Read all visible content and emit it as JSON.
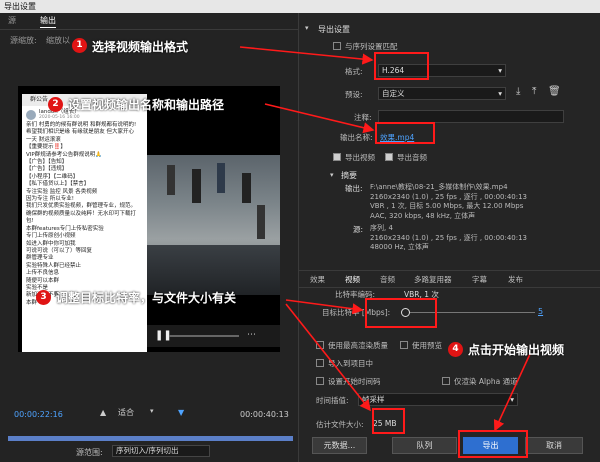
{
  "window": {
    "title": "导出设置"
  },
  "left": {
    "tabs": [
      "源",
      "输出"
    ],
    "source_scaling_label": "源缩放:",
    "source_scaling_value": "缩放以",
    "phone": {
      "group": "群公告",
      "author": "landon（组长）",
      "date": "2020-05-16 16:00",
      "lines": [
        "亲们 村勇的的候有群说明 和群规都有说明的!",
        "希望我们相识是缘 有缘就是朋友 但大家开心",
        "一天 财运滚滚",
        "【重要提示‼️】",
        "VIP群规请参考公告群规说明🙏",
        "【广告】【告知】",
        "【广告】【违规】",
        "【小程序】【二维码】",
        "【私下借贷以上】【禁言】",
        "专注实验 监控 风景 各类视频",
        "因为专注 所以专业!",
        "我们只发优质实验视频，群管理专业，规范。",
        "确保群的视频质量以及纯粹！无水印可下载打",
        "包!",
        "本群features专门上传私密实验",
        "专门上传原创小视频",
        "如进入群中你可加我",
        "可说可说（可以了）等回复",
        "群管理专业",
        "实验特殊人群已经禁止",
        "上传不良信息",
        "随便可以本群",
        "实验不是",
        "新加进入不要",
        "本群"
      ]
    },
    "timecode_in": "00:00:22:16",
    "fit": "适合",
    "timecode_out": "00:00:40:13",
    "range_label": "源范围:",
    "range_value": "序列切入/序列切出"
  },
  "right": {
    "section_title": "导出设置",
    "match_sequence": "与序列设置匹配",
    "format_label": "格式:",
    "format_value": "H.264",
    "preset_label": "预设:",
    "preset_value": "自定义",
    "comment_label": "注释:",
    "output_name_label": "输出名称:",
    "output_name_value": "效果.mp4",
    "export_video": "导出视频",
    "export_audio": "导出音频",
    "summary_title": "摘要",
    "output_label": "输出:",
    "output_lines": [
      "F:\\anne\\教程\\08-21_多媒体制作\\效果.mp4",
      "2160x2340 (1.0) , 25 fps , 逐行 , 00:00:40:13",
      "VBR , 1 次, 目标 5.00 Mbps, 最大 12.00 Mbps",
      "AAC, 320 kbps, 48 kHz, 立体声"
    ],
    "source_label": "源:",
    "source_lines": [
      "序列, 4",
      "2160x2340 (1.0) , 25 fps , 逐行 , 00:00:40:13",
      "48000 Hz, 立体声"
    ],
    "subtabs": [
      "效果",
      "视频",
      "音频",
      "多路复用器",
      "字幕",
      "发布"
    ],
    "bitrate_encoding": "比特率编码:",
    "bitrate_encoding_value": "VBR, 1 次",
    "target_bitrate_label": "目标比特率 [Mbps]:",
    "target_bitrate_value": "5",
    "max_render_quality": "使用最高渲染质量",
    "use_preview": "使用预览",
    "import_project": "导入到项目中",
    "set_start_timecode": "设置开始时间码",
    "alpha_only": "仅渲染 Alpha 通道",
    "time_interp_label": "时间插值:",
    "time_interp_value": "帧采样",
    "est_size_label": "估计文件大小:",
    "est_size_value": "25 MB",
    "btn_metadata": "元数据...",
    "btn_queue": "队列",
    "btn_export": "导出",
    "btn_cancel": "取消"
  },
  "callouts": [
    {
      "num": "1",
      "text": "选择视频输出格式"
    },
    {
      "num": "2",
      "text": "设置视频输出名称和输出路径"
    },
    {
      "num": "3",
      "text": "调整目标比特率，与文件大小有关"
    },
    {
      "num": "4",
      "text": "点击开始输出视频"
    }
  ],
  "colors": {
    "accent": "#2e6fd0",
    "annotation": "#ff1a1a",
    "link": "#4ea3ff"
  }
}
